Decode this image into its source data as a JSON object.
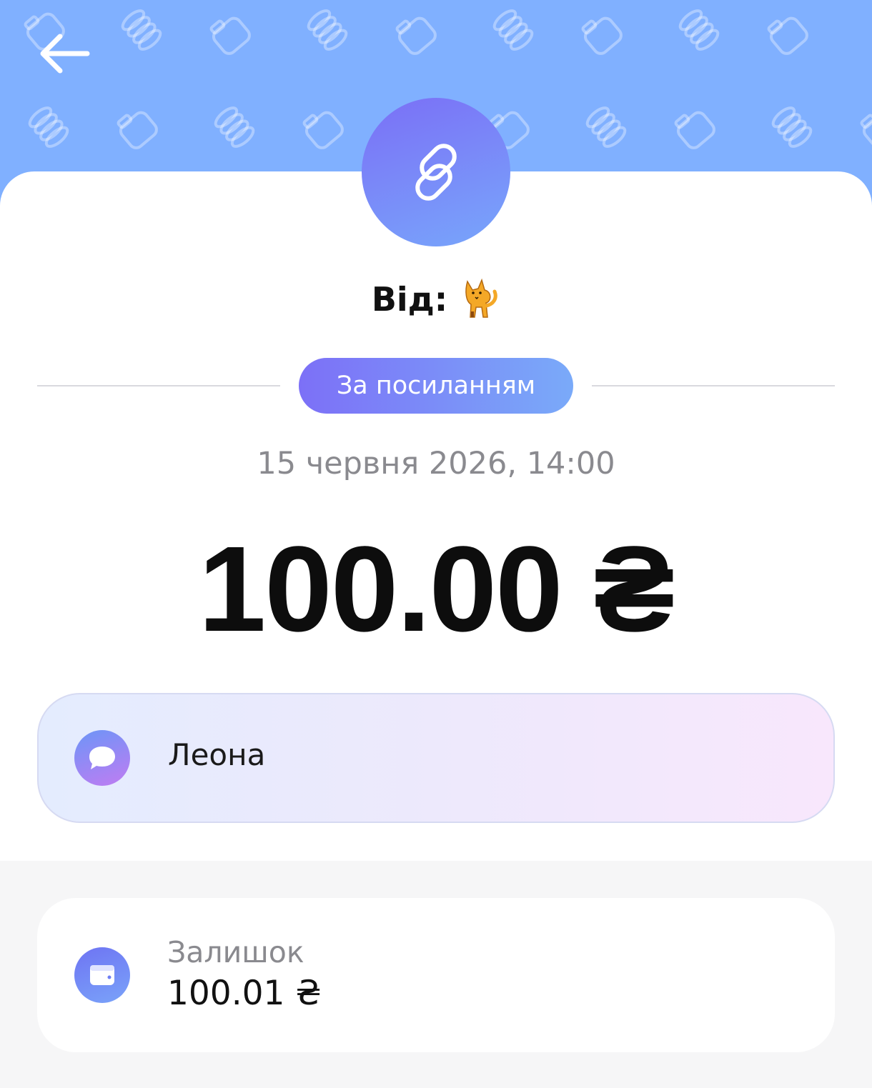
{
  "header": {
    "back_icon": "arrow-left-icon",
    "background_color": "#80b0ff",
    "pattern_icons": [
      "jar-icon",
      "coins-icon"
    ]
  },
  "transfer": {
    "type_icon": "link-icon",
    "from_label": "Від:",
    "from_avatar": "cat-emoji",
    "method_badge": "За посиланням",
    "date": "15 червня 2026, 14:00",
    "amount": "100.00 ₴"
  },
  "comment": {
    "icon": "chat-bubble-icon",
    "text": "Леона"
  },
  "balance": {
    "icon": "wallet-icon",
    "label": "Залишок",
    "value": "100.01 ₴"
  },
  "colors": {
    "accent_start": "#7c70f7",
    "accent_end": "#7aaaf9"
  }
}
